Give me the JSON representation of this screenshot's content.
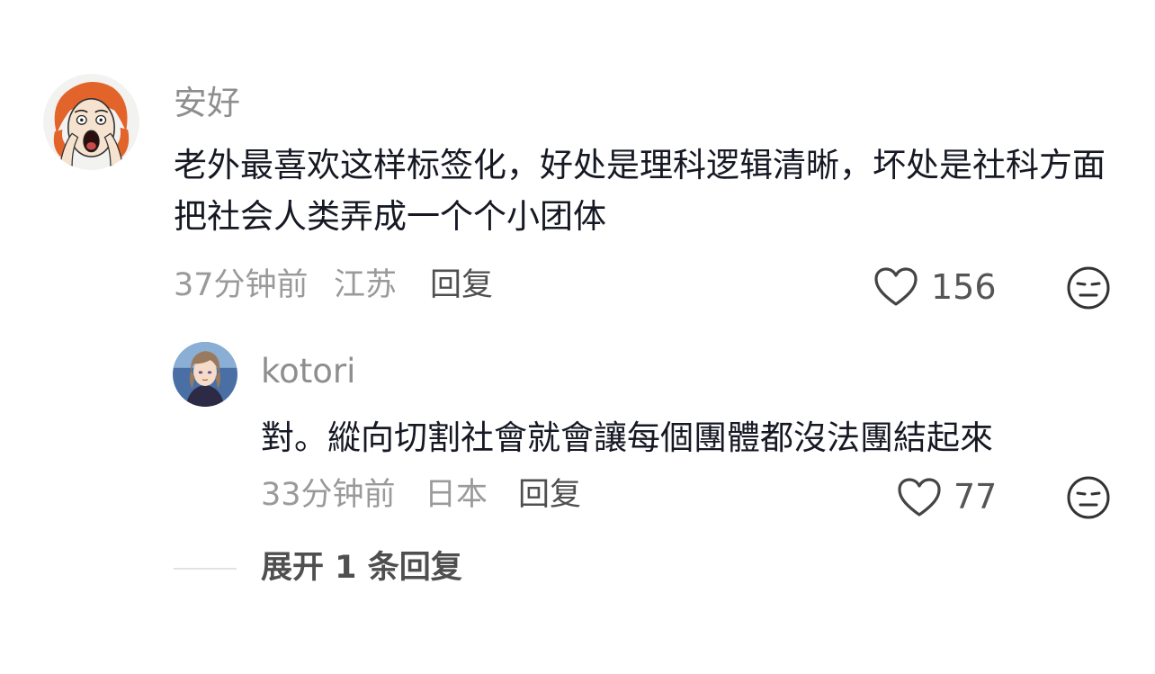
{
  "comment": {
    "username": "安好",
    "content": "老外最喜欢这样标签化，好处是理科逻辑清晰，坏处是社科方面把社会人类弄成一个个小团体",
    "time": "37分钟前",
    "location": "江苏",
    "reply_label": "回复",
    "like_count": "156"
  },
  "reply": {
    "username": "kotori",
    "content": "對。縱向切割社會就會讓每個團體都沒法團結起來",
    "time": "33分钟前",
    "location": "日本",
    "reply_label": "回复",
    "like_count": "77"
  },
  "expand": {
    "label": "展开 1 条回复"
  },
  "colors": {
    "text_primary": "#161823",
    "text_secondary": "#8e8e8e",
    "background": "#ffffff"
  }
}
